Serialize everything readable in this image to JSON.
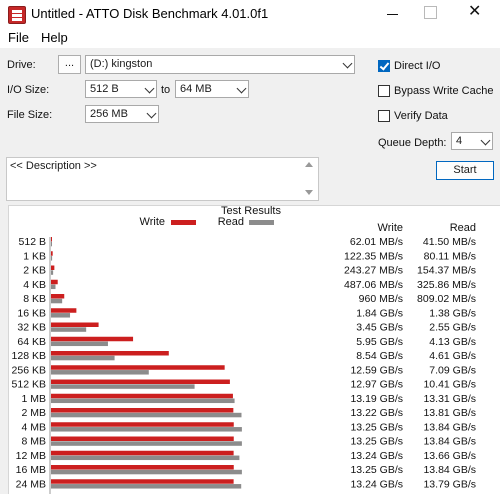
{
  "window": {
    "title": "Untitled - ATTO Disk Benchmark 4.01.0f1",
    "close_glyph": "✕"
  },
  "menu": [
    "File",
    "Help"
  ],
  "controls": {
    "drive_label": "Drive:",
    "drive_browse": "...",
    "drive_value": "(D:) kingston",
    "io_size_label": "I/O Size:",
    "io_from": "512 B",
    "io_to_label": "to",
    "io_to": "64 MB",
    "file_size_label": "File Size:",
    "file_size": "256 MB",
    "direct_io_label": "Direct I/O",
    "direct_io_checked": true,
    "bypass_cache_label": "Bypass Write Cache",
    "bypass_cache_checked": false,
    "verify_data_label": "Verify Data",
    "verify_data_checked": false,
    "queue_depth_label": "Queue Depth:",
    "queue_depth": "4",
    "start_label": "Start",
    "description": "<< Description >>"
  },
  "chart_data": {
    "type": "bar",
    "title": "Test Results",
    "legend": [
      {
        "name": "Write",
        "color": "#cc1f1f"
      },
      {
        "name": "Read",
        "color": "#8c8c8c"
      }
    ],
    "col_write": "Write",
    "col_read": "Read",
    "unit_note": "bar length proportional to transfer rate",
    "max_mbs": 14500,
    "categories": [
      "512 B",
      "1 KB",
      "2 KB",
      "4 KB",
      "8 KB",
      "16 KB",
      "32 KB",
      "64 KB",
      "128 KB",
      "256 KB",
      "512 KB",
      "1 MB",
      "2 MB",
      "4 MB",
      "8 MB",
      "12 MB",
      "16 MB",
      "24 MB"
    ],
    "series": [
      {
        "name": "Write",
        "values_mbs": [
          62.01,
          122.35,
          243.27,
          487.06,
          960,
          1840,
          3450,
          5950,
          8540,
          12590,
          12970,
          13190,
          13220,
          13250,
          13250,
          13240,
          13250,
          13240
        ],
        "labels": [
          "62.01 MB/s",
          "122.35 MB/s",
          "243.27 MB/s",
          "487.06 MB/s",
          "960 MB/s",
          "1.84 GB/s",
          "3.45 GB/s",
          "5.95 GB/s",
          "8.54 GB/s",
          "12.59 GB/s",
          "12.97 GB/s",
          "13.19 GB/s",
          "13.22 GB/s",
          "13.25 GB/s",
          "13.25 GB/s",
          "13.24 GB/s",
          "13.25 GB/s",
          "13.24 GB/s"
        ]
      },
      {
        "name": "Read",
        "values_mbs": [
          41.5,
          80.11,
          154.37,
          325.86,
          809.02,
          1380,
          2550,
          4130,
          4610,
          7090,
          10410,
          13310,
          13810,
          13840,
          13840,
          13660,
          13840,
          13790
        ],
        "labels": [
          "41.50 MB/s",
          "80.11 MB/s",
          "154.37 MB/s",
          "325.86 MB/s",
          "809.02 MB/s",
          "1.38 GB/s",
          "2.55 GB/s",
          "4.13 GB/s",
          "4.61 GB/s",
          "7.09 GB/s",
          "10.41 GB/s",
          "13.31 GB/s",
          "13.81 GB/s",
          "13.84 GB/s",
          "13.84 GB/s",
          "13.66 GB/s",
          "13.84 GB/s",
          "13.79 GB/s"
        ]
      }
    ]
  }
}
